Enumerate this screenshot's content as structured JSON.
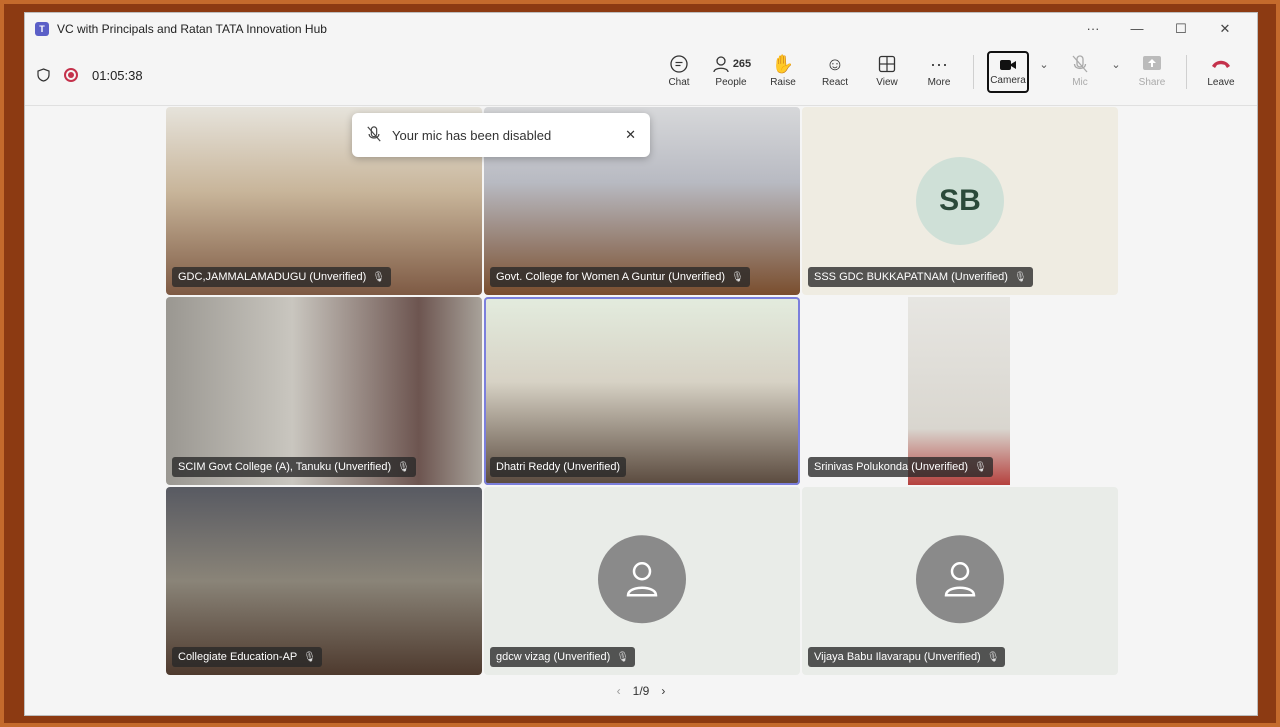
{
  "window": {
    "title": "VC with Principals and Ratan TATA Innovation Hub",
    "menu_label": "···",
    "minimize": "—",
    "maximize": "☐",
    "close": "✕"
  },
  "toolbar": {
    "timer": "01:05:38",
    "chat": "Chat",
    "people": "People",
    "people_count": "265",
    "raise": "Raise",
    "react": "React",
    "view": "View",
    "more": "More",
    "camera": "Camera",
    "mic": "Mic",
    "share": "Share",
    "leave": "Leave"
  },
  "toast": {
    "message": "Your mic has been disabled"
  },
  "tiles": [
    {
      "name": "GDC,JAMMALAMADUGU (Unverified)"
    },
    {
      "name": "Govt. College for Women A Guntur (Unverified)"
    },
    {
      "name": "SSS GDC BUKKAPATNAM (Unverified)",
      "initials": "SB"
    },
    {
      "name": "SCIM Govt College (A), Tanuku (Unverified)"
    },
    {
      "name": "Dhatri Reddy (Unverified)"
    },
    {
      "name": "Srinivas Polukonda (Unverified)"
    },
    {
      "name": "Collegiate Education-AP"
    },
    {
      "name": "gdcw vizag (Unverified)"
    },
    {
      "name": "Vijaya Babu Ilavarapu (Unverified)"
    }
  ],
  "pager": {
    "label": "1/9",
    "prev": "‹",
    "next": "›"
  },
  "colors": {
    "accent": "#5b5fc7",
    "leave": "#c4314b",
    "recording": "#c4314b"
  }
}
